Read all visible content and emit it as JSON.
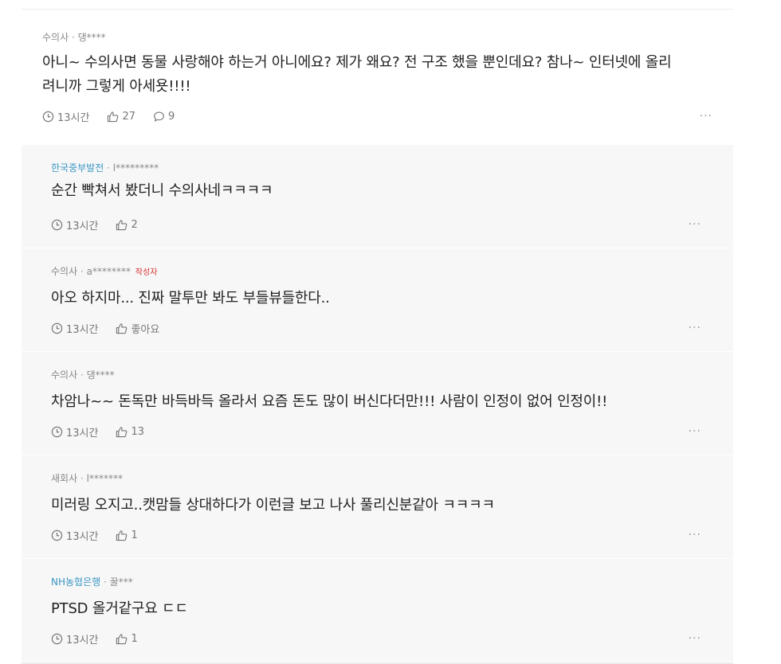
{
  "comments": [
    {
      "company": "수의사",
      "separator": "·",
      "user": "댕****",
      "text_line1": "아니~ 수의사면 동물 사랑해야 하는거 아니에요? 제가 왜요? 전 구조 했을 뿐인데요? 참나~ 인터넷에 올리",
      "text_line2": "려니까 그렇게 아세욧!!!!",
      "time": "13시간",
      "likes": "27",
      "replies": "9",
      "more": "···"
    }
  ],
  "replies": [
    {
      "company": "한국중부발전",
      "separator": "·",
      "user": "l*********",
      "text": "순간 빡쳐서 봤더니 수의사네ㅋㅋㅋㅋ",
      "time": "13시간",
      "likes": "2",
      "more": "···"
    },
    {
      "company": "수의사",
      "separator": "·",
      "user": "a********",
      "author_tag": "작성자",
      "text": "아오 하지마... 진짜 말투만 봐도 부들뷰들한다..",
      "time": "13시간",
      "likes": "좋아요",
      "more": "···"
    },
    {
      "company": "수의사",
      "separator": "·",
      "user": "댕****",
      "text": "차암나~~ 돈독만 바득바득 올라서 요즘 돈도 많이 버신다더만!!! 사람이 인정이 없어 인정이!!",
      "time": "13시간",
      "likes": "13",
      "more": "···"
    },
    {
      "company": "새회사",
      "separator": "·",
      "user": "l*******",
      "text": "미러링 오지고..캣맘들 상대하다가 이런글 보고 나사 풀리신분같아 ㅋㅋㅋㅋ",
      "time": "13시간",
      "likes": "1",
      "more": "···"
    },
    {
      "company": "NH농협은행",
      "separator": "·",
      "user": "꿀***",
      "text": "PTSD 올거같구요 ㄷㄷ",
      "time": "13시간",
      "likes": "1",
      "more": "···"
    }
  ],
  "colors": {
    "company_link": "#3a97c4",
    "author_tag": "#d93232",
    "reply_bg": "#f7f7f7"
  },
  "icons": [
    "clock-icon",
    "thumbs-up-icon",
    "speech-bubble-icon",
    "more-icon"
  ]
}
